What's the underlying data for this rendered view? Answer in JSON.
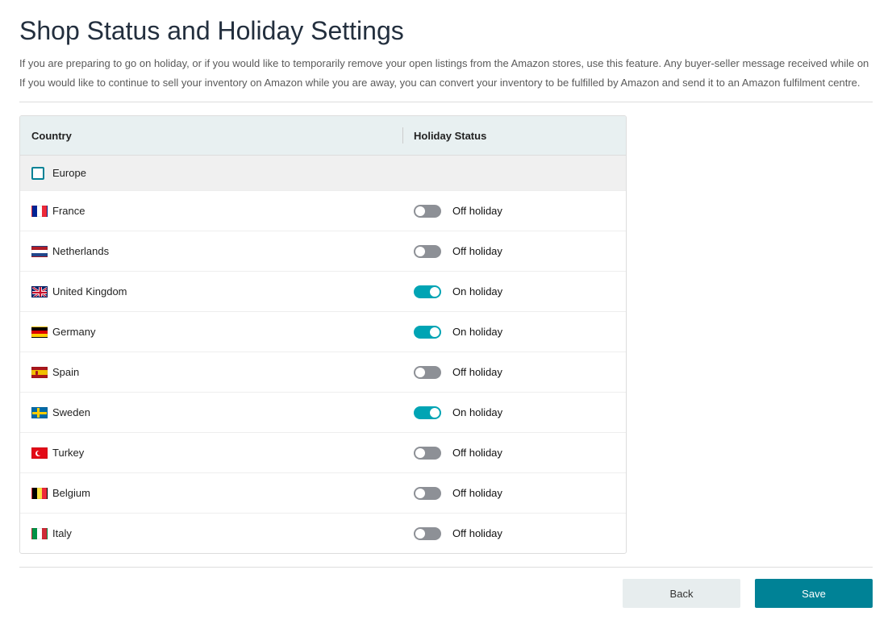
{
  "page": {
    "title": "Shop Status and Holiday Settings",
    "intro1": "If you are preparing to go on holiday, or if you would like to temporarily remove your open listings from the Amazon stores, use this feature. Any buyer-seller message received while on",
    "intro2": "If you would like to continue to sell your inventory on Amazon while you are away, you can convert your inventory to be fulfilled by Amazon and send it to an Amazon fulfilment centre."
  },
  "table": {
    "header_country": "Country",
    "header_status": "Holiday Status",
    "region": "Europe"
  },
  "status_labels": {
    "on": "On holiday",
    "off": "Off holiday"
  },
  "countries": [
    {
      "name": "France",
      "flag": "fr",
      "on_holiday": false
    },
    {
      "name": "Netherlands",
      "flag": "nl",
      "on_holiday": false
    },
    {
      "name": "United Kingdom",
      "flag": "uk",
      "on_holiday": true
    },
    {
      "name": "Germany",
      "flag": "de",
      "on_holiday": true
    },
    {
      "name": "Spain",
      "flag": "es",
      "on_holiday": false
    },
    {
      "name": "Sweden",
      "flag": "se",
      "on_holiday": true
    },
    {
      "name": "Turkey",
      "flag": "tr",
      "on_holiday": false
    },
    {
      "name": "Belgium",
      "flag": "be",
      "on_holiday": false
    },
    {
      "name": "Italy",
      "flag": "it",
      "on_holiday": false
    }
  ],
  "buttons": {
    "back": "Back",
    "save": "Save"
  }
}
